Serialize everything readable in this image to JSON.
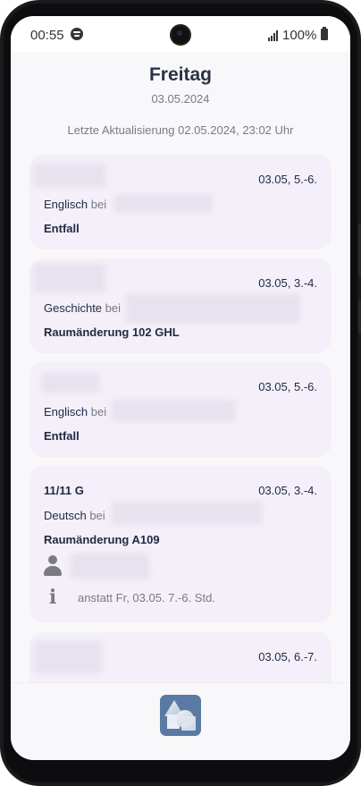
{
  "status_bar": {
    "time": "00:55",
    "battery": "100%",
    "icons": [
      "spotify-icon",
      "signal-icon",
      "battery-icon"
    ]
  },
  "header": {
    "day": "Freitag",
    "date": "03.05.2024",
    "last_update": "Letzte Aktualisierung 02.05.2024, 23:02 Uhr"
  },
  "entries": [
    {
      "class": "",
      "time": "03.05, 5.-6.",
      "subject": "Englisch",
      "bei": "bei",
      "status": "Entfall"
    },
    {
      "class": "",
      "time": "03.05, 3.-4.",
      "subject": "Geschichte",
      "bei": "bei",
      "status": "Raumänderung 102 GHL"
    },
    {
      "class": "",
      "time": "03.05, 5.-6.",
      "subject": "Englisch",
      "bei": "bei",
      "status": "Entfall"
    },
    {
      "class": "11/11 G",
      "time": "03.05, 3.-4.",
      "subject": "Deutsch",
      "bei": "bei",
      "status": "Raumänderung A109",
      "info": "anstatt Fr, 03.05. 7.-6. Std."
    },
    {
      "class": "",
      "time": "03.05, 6.-7."
    }
  ],
  "colors": {
    "card_bg": "#f4eff8",
    "title": "#2b3245",
    "text_dark": "#1e2a44",
    "text_muted": "#7a7a80",
    "logo": "#5b7aa3"
  }
}
